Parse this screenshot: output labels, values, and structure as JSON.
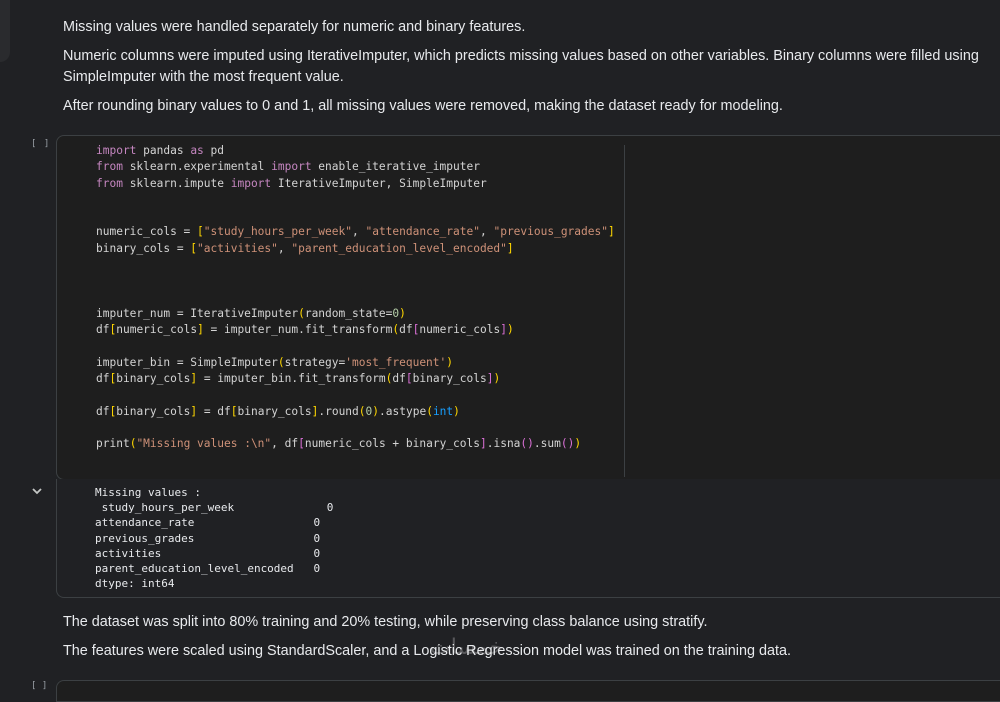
{
  "text_cell_top": {
    "paragraphs": [
      "Missing values were handled separately for numeric and binary features.",
      "Numeric columns were imputed using IterativeImputer, which predicts missing values based on other variables. Binary columns were filled using SimpleImputer with the most frequent value.",
      "After rounding binary values to 0 and 1, all missing values were removed, making the dataset ready for modeling."
    ]
  },
  "code_cell": {
    "run_marker": "[ ]",
    "lines": {
      "l1_kw": "import",
      "l1_rest": " pandas ",
      "l1_kw2": "as",
      "l1_end": " pd",
      "l2_kw": "from",
      "l2_mid": " sklearn.experimental ",
      "l2_kw2": "import",
      "l2_end": " enable_iterative_imputer",
      "l3_kw": "from",
      "l3_mid": " sklearn.impute ",
      "l3_kw2": "import",
      "l3_end": " IterativeImputer, SimpleImputer",
      "l4_a": "numeric_cols = ",
      "l4_s1": "\"study_hours_per_week\"",
      "l4_s2": "\"attendance_rate\"",
      "l4_s3": "\"previous_grades\"",
      "l5_a": "binary_cols = ",
      "l5_s1": "\"activities\"",
      "l5_s2": "\"parent_education_level_encoded\"",
      "l6_a": "imputer_num = IterativeImputer",
      "l6_b": "random_state=",
      "l6_n": "0",
      "l7_a": "df",
      "l7_b": "numeric_cols",
      "l7_c": " = imputer_num.fit_transform",
      "l7_d": "df",
      "l7_e": "numeric_cols",
      "l8_a": "imputer_bin = SimpleImputer",
      "l8_b": "strategy=",
      "l8_s": "'most_frequent'",
      "l9_a": "df",
      "l9_b": "binary_cols",
      "l9_c": " = imputer_bin.fit_transform",
      "l9_d": "df",
      "l9_e": "binary_cols",
      "l10_a": "df",
      "l10_b": "binary_cols",
      "l10_c": " = df",
      "l10_d": "binary_cols",
      "l10_e": ".round",
      "l10_n": "0",
      "l10_f": ".astype",
      "l10_g": "int",
      "l11_a": "print",
      "l11_s": "\"Missing values :\\n\"",
      "l11_b": ", df",
      "l11_c": "numeric_cols + binary_cols",
      "l11_d": ".isna",
      "l11_e": ".sum"
    }
  },
  "output": {
    "collapse_icon": "chevron-down",
    "text": "Missing values :\n study_hours_per_week              0\nattendance_rate                  0\nprevious_grades                  0\nactivities                       0\nparent_education_level_encoded   0\ndtype: int64"
  },
  "text_cell_bottom": {
    "paragraphs": [
      "The dataset was split into 80% training and 20% testing, while preserving class balance using stratify.",
      "The features were scaled using StandardScaler, and a Logistic Regression model was trained on the training data."
    ]
  },
  "next_cell": {
    "run_marker": "[ ]"
  },
  "watermark": "خمسات",
  "colors": {
    "background": "#202124",
    "code_bg": "#1e1e1e",
    "keyword": "#c586c0",
    "string": "#ce9178"
  }
}
